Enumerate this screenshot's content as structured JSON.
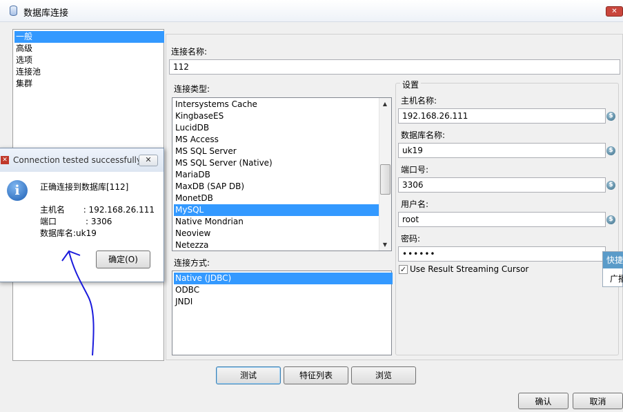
{
  "window": {
    "title": "数据库连接",
    "close_glyph": "✕"
  },
  "nav": {
    "items": [
      "一般",
      "高级",
      "选项",
      "连接池",
      "集群"
    ],
    "selected_index": 0
  },
  "general": {
    "conn_name_label": "连接名称:",
    "conn_name_value": "112",
    "conn_type_label": "连接类型:",
    "conn_types": [
      "Intersystems Cache",
      "KingbaseES",
      "LucidDB",
      "MS Access",
      "MS SQL Server",
      "MS SQL Server (Native)",
      "MariaDB",
      "MaxDB (SAP DB)",
      "MonetDB",
      "MySQL",
      "Native Mondrian",
      "Neoview",
      "Netezza"
    ],
    "conn_type_selected": "MySQL",
    "access_label": "连接方式:",
    "access_methods": [
      "Native (JDBC)",
      "ODBC",
      "JNDI"
    ],
    "access_selected": "Native (JDBC)"
  },
  "settings": {
    "title": "设置",
    "host_label": "主机名称:",
    "host_value": "192.168.26.111",
    "db_label": "数据库名称:",
    "db_value": "uk19",
    "port_label": "端口号:",
    "port_value": "3306",
    "user_label": "用户名:",
    "user_value": "root",
    "password_label": "密码:",
    "password_value": "••••••",
    "cursor_label": "Use Result Streaming Cursor",
    "cursor_checked": true
  },
  "buttons": {
    "test": "测试",
    "features": "特征列表",
    "browse": "浏览",
    "ok": "确认",
    "cancel": "取消"
  },
  "quick_tip": {
    "header": "快捷",
    "body": "广播"
  },
  "dialog": {
    "title": "Connection tested successfully",
    "message": "正确连接到数据库[112]",
    "host_line": "主机名       : 192.168.26.111",
    "port_line": "端口           : 3306",
    "db_line": "数据库名:uk19",
    "ok_button": "确定(O)"
  },
  "colors": {
    "selection": "#3399ff",
    "annotation_stroke": "#1a1adc"
  },
  "icons": [
    "database-icon",
    "dollar-variable-icon",
    "info-icon",
    "error-icon",
    "close-icon",
    "checkmark-icon"
  ]
}
